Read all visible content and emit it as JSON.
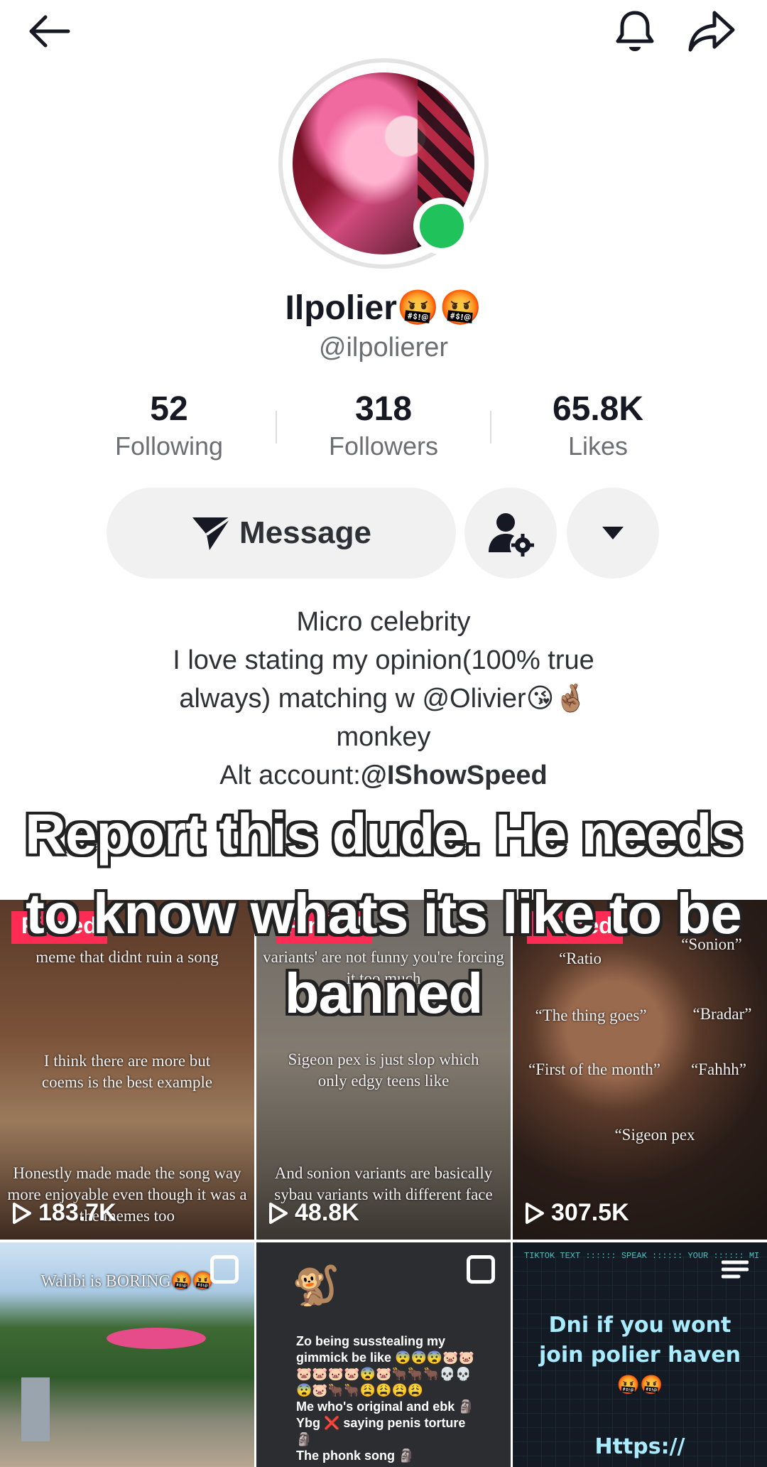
{
  "header": {
    "back_icon": "arrow-left-icon",
    "notification_icon": "bell-icon",
    "share_icon": "share-arrow-icon"
  },
  "profile": {
    "display_name": "Ilpolier",
    "name_emojis": "🤬🤬",
    "username": "@ilpolierer",
    "online": true,
    "online_color": "#20c25b"
  },
  "stats": [
    {
      "value": "52",
      "label": "Following"
    },
    {
      "value": "318",
      "label": "Followers"
    },
    {
      "value": "65.8K",
      "label": "Likes"
    }
  ],
  "actions": {
    "message_label": "Message",
    "message_icon": "send-plane-icon",
    "friend_settings_icon": "user-gear-icon",
    "more_icon": "caret-down-icon"
  },
  "bio": {
    "line1": "Micro celebrity",
    "line2": "I love stating my opinion(100% true",
    "line3": "always) matching w @Olivier😘🤞🏽",
    "line4": "monkey",
    "alt_prefix": "Alt account:",
    "alt_handle": "@IShowSpeed"
  },
  "overlay_caption": "Report this dude. He needs to know whats its like to be banned",
  "videos": [
    {
      "badge": "Pinned",
      "views": "183.7K",
      "text_top": "meme that didnt ruin a song",
      "text_mid": "I think there are more but coems is the best example",
      "text_bottom": "Honestly made made the song way more enjoyable even though it was a the memes too"
    },
    {
      "badge": "Pinned",
      "views": "48.8K",
      "text_top": "variants' are not funny you're forcing it too much",
      "text_mid": "Sigeon pex is just slop which only edgy teens like",
      "text_bottom": "And sonion variants are basically sybau variants with different face"
    },
    {
      "badge": "Pinned",
      "views": "307.5K",
      "text_ratio": "“Ratio",
      "text_sonion": "“Sonion”",
      "text_goes": "“The thing goes”",
      "text_bradar": "“Bradar”",
      "text_first": "“First of the month”",
      "text_fahhh": "“Fahhh”",
      "text_sigeon": "“Sigeon pex"
    },
    {
      "views": "",
      "title": "Walibi is BORING🤬🤬"
    },
    {
      "views": "",
      "monkey": "🐒",
      "lines": [
        "Zo being susstealing my",
        "gimmick be like 😨😨😨🐷🐷",
        "🐷🐷🐷🐷😨🐷🐂🐂🐂💀💀",
        "😨🐷🐂🐂😩😩😩😩",
        "Me who's original and ebk 🗿",
        "Ybg ❌ saying penis torture",
        "🗿",
        "The phonk song 🗿"
      ]
    },
    {
      "views": "",
      "tiktok_bar": "TIKTOK TEXT :::::: SPEAK :::::: YOUR :::::: MIND",
      "title_line1": "Dni if you wont",
      "title_line2": "join polier haven",
      "emojis": "🤬🤬",
      "url": "Https://"
    }
  ]
}
